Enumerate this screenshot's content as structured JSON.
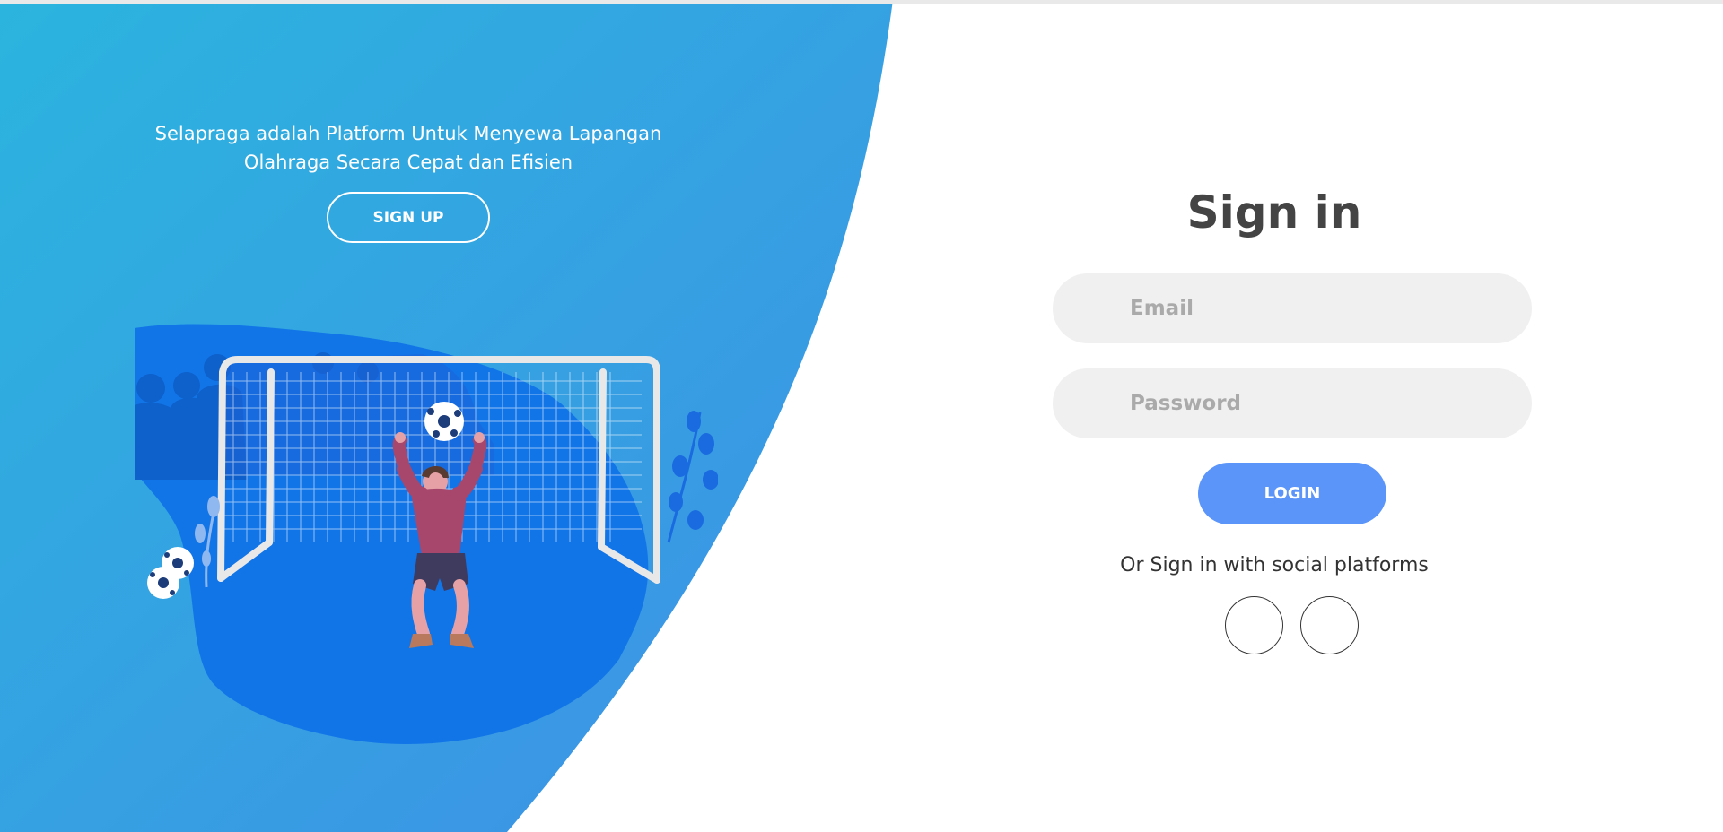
{
  "hero": {
    "tagline_line1": "Selapraga adalah Platform Untuk Menyewa Lapangan",
    "tagline_line2": "Olahraga Secara Cepat dan Efisien",
    "signup_label": "SIGN UP",
    "illustration_icon": "goalkeeper-illustration"
  },
  "signin": {
    "title": "Sign in",
    "email_placeholder": "Email",
    "password_placeholder": "Password",
    "login_label": "LOGIN",
    "social_text": "Or Sign in with social platforms",
    "social_buttons": [
      "social-button",
      "social-button"
    ]
  },
  "colors": {
    "gradient_start": "#2bb3dd",
    "gradient_end": "#3f8fe6",
    "login_button": "#5b95f9",
    "input_bg": "#f0f0f0",
    "title_text": "#444444"
  }
}
